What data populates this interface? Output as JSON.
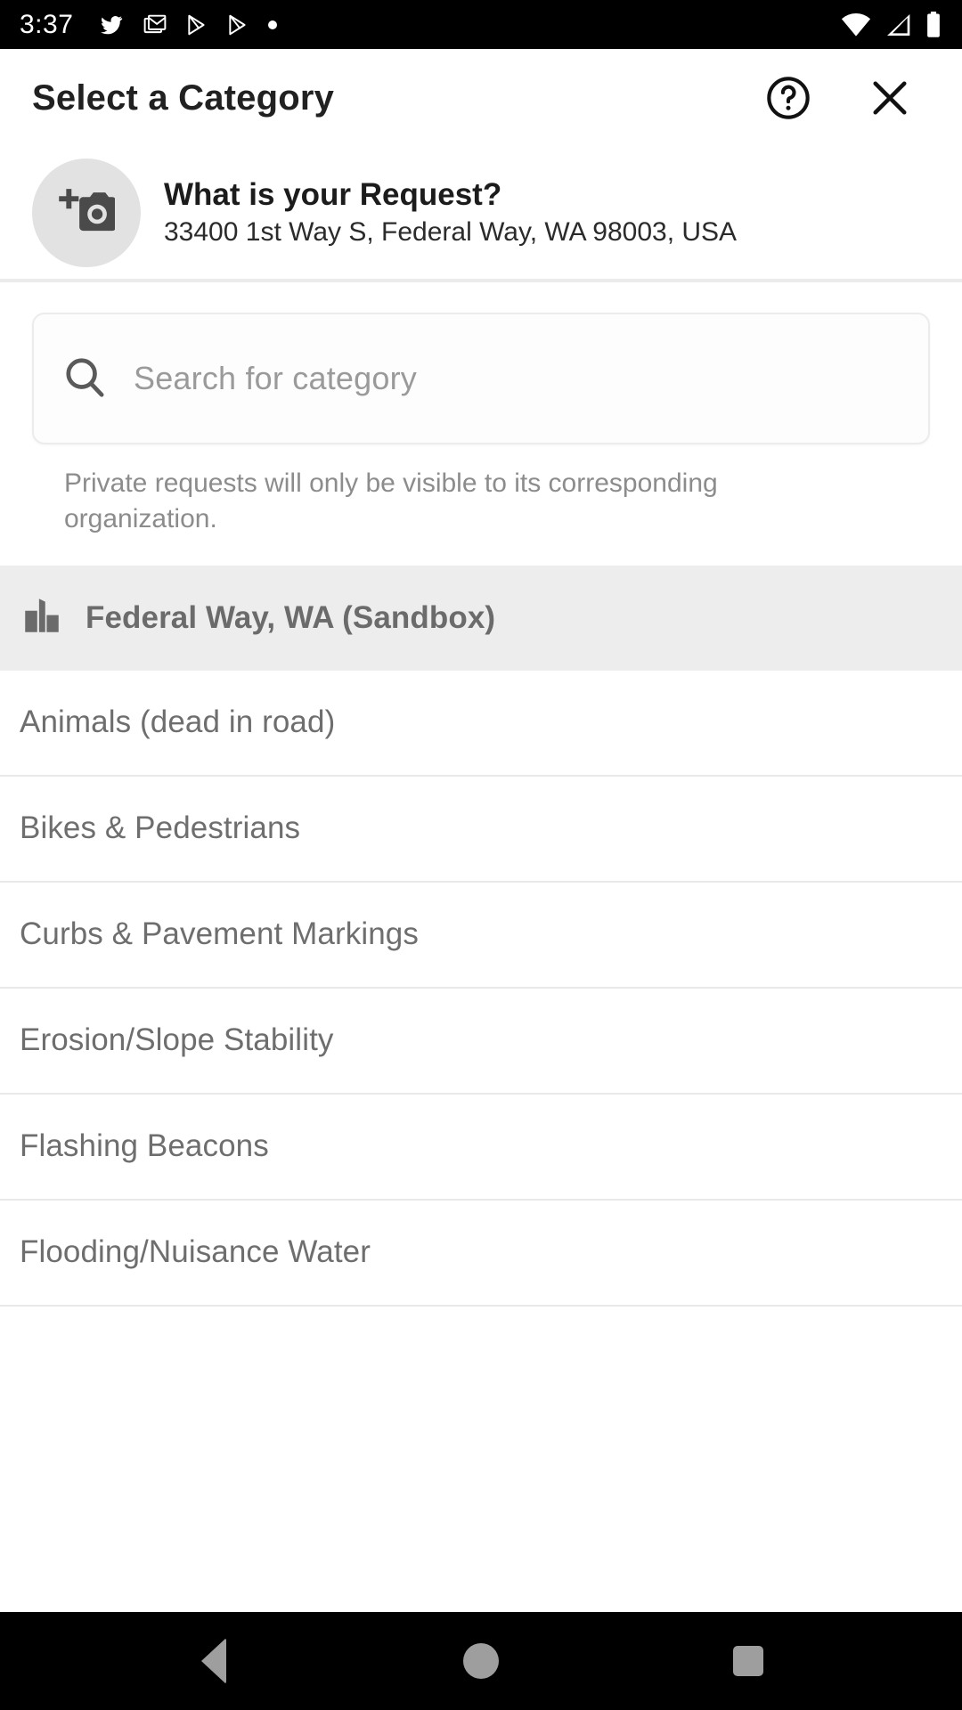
{
  "status_bar": {
    "time": "3:37",
    "left_icons": [
      "twitter-icon",
      "gmail-icon",
      "play-store-icon",
      "play-store-icon",
      "dot-icon"
    ],
    "right_icons": [
      "wifi-icon",
      "cellular-signal-icon",
      "battery-icon"
    ]
  },
  "header": {
    "title": "Select a Category",
    "help_icon": "help-circle-icon",
    "close_icon": "close-icon"
  },
  "request": {
    "avatar_icon": "add-photo-camera-icon",
    "title": "What is your Request?",
    "address": "33400 1st Way S, Federal Way, WA 98003, USA"
  },
  "search": {
    "icon": "search-icon",
    "placeholder": "Search for category",
    "value": ""
  },
  "privacy_note": "Private requests will only be visible to its corresponding organization.",
  "organization": {
    "icon": "city-buildings-icon",
    "name": "Federal Way, WA (Sandbox)"
  },
  "categories": [
    {
      "label": "Animals (dead in road)"
    },
    {
      "label": "Bikes & Pedestrians"
    },
    {
      "label": "Curbs & Pavement Markings"
    },
    {
      "label": "Erosion/Slope Stability"
    },
    {
      "label": "Flashing Beacons"
    },
    {
      "label": "Flooding/Nuisance Water"
    }
  ],
  "nav_bar": {
    "back": "back-icon",
    "home": "home-icon",
    "recents": "recents-icon"
  },
  "colors": {
    "status_bar_bg": "#000000",
    "page_bg": "#ffffff",
    "org_band_bg": "#ededed",
    "divider": "#e9e9e9",
    "text_primary": "#212121",
    "text_secondary": "#6e6e6e",
    "placeholder": "#9a9a9a",
    "nav_icon": "#9e9e9e"
  }
}
